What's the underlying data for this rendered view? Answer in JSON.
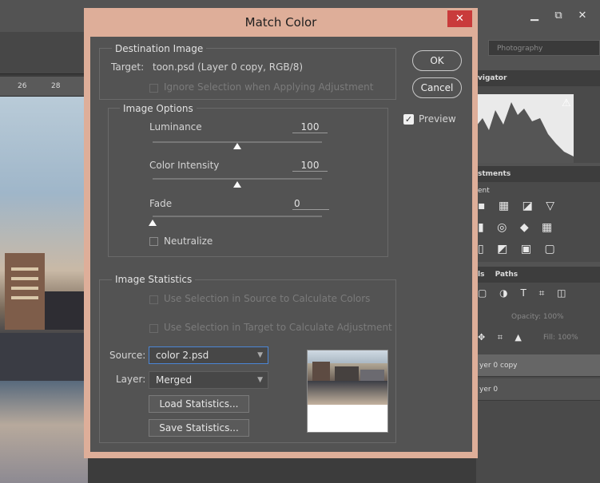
{
  "dialog": {
    "title": "Match Color",
    "close_glyph": "✕",
    "destination": {
      "group_title": "Destination Image",
      "target_label": "Target:",
      "target_value": "toon.psd (Layer 0 copy, RGB/8)",
      "ignore_selection_label": "Ignore Selection when Applying Adjustment"
    },
    "image_options": {
      "group_title": "Image Options",
      "luminance_label": "Luminance",
      "luminance_value": "100",
      "luminance_level": 0.5,
      "intensity_label": "Color Intensity",
      "intensity_value": "100",
      "intensity_level": 0.5,
      "fade_label": "Fade",
      "fade_value": "0",
      "fade_level": 0,
      "neutralize_label": "Neutralize"
    },
    "statistics": {
      "group_title": "Image Statistics",
      "use_source_label": "Use Selection in Source to Calculate Colors",
      "use_target_label": "Use Selection in Target to Calculate Adjustment",
      "source_label": "Source:",
      "source_value": "color 2.psd",
      "layer_label": "Layer:",
      "layer_value": "Merged",
      "load_label": "Load Statistics...",
      "save_label": "Save Statistics..."
    },
    "ok_label": "OK",
    "cancel_label": "Cancel",
    "preview_label": "Preview"
  },
  "workspace": {
    "workspace_select": "Photography",
    "ruler": [
      "26",
      "28"
    ],
    "navigator_tab": "vigator",
    "adjustments_tab": "stments",
    "adjust_sub": "ent",
    "layers_tabs": [
      "ls",
      "Paths"
    ],
    "opacity_label": "Opacity:",
    "opacity_value": "100%",
    "fill_label": "Fill:",
    "fill_value": "100%",
    "layers": [
      "yer 0 copy",
      "yer 0"
    ]
  },
  "colors": {
    "dialog_frame": "#deae99",
    "dialog_body": "#535353",
    "close_button": "#c93b3b",
    "focus_border": "#4b86d6"
  }
}
